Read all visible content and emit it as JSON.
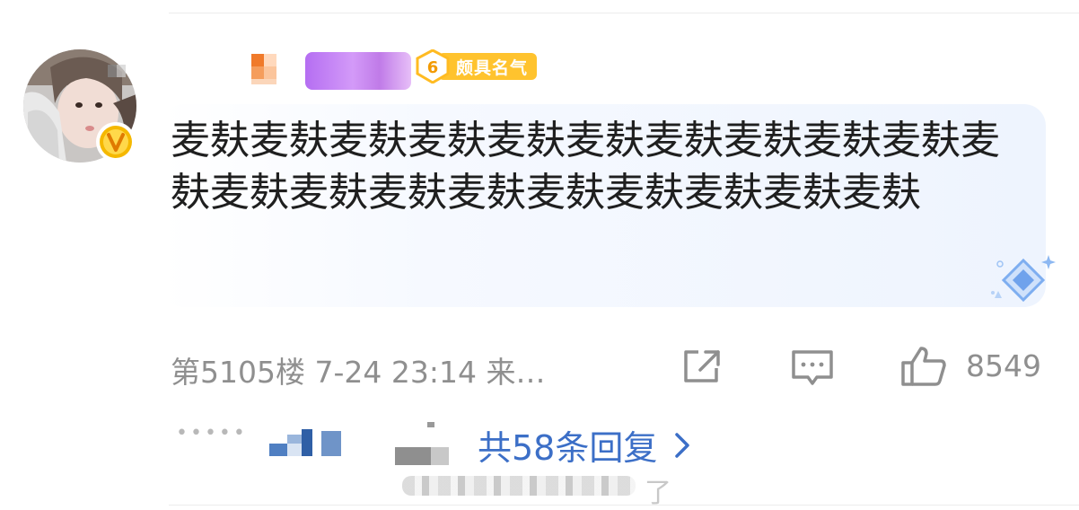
{
  "user": {
    "fame_level": "6",
    "fame_label": "颇具名气"
  },
  "comment": {
    "text": "麦麸麦麸麦麸麦麸麦麸麦麸麦麸麦麸麦麸麦麸麦麸麦麸麦麸麦麸麦麸麦麸麦麸麦麸麦麸麦麸"
  },
  "meta": {
    "floor_time": "第5105楼 7-24 23:14 来…",
    "like_count": "8549"
  },
  "replies": {
    "dots": "•••••",
    "link_label": "共58条回复",
    "faded_suffix": "了"
  },
  "colors": {
    "link": "#3c6fc7",
    "fame_badge": "#ffc32e",
    "meta_text": "#8f8f8f"
  }
}
